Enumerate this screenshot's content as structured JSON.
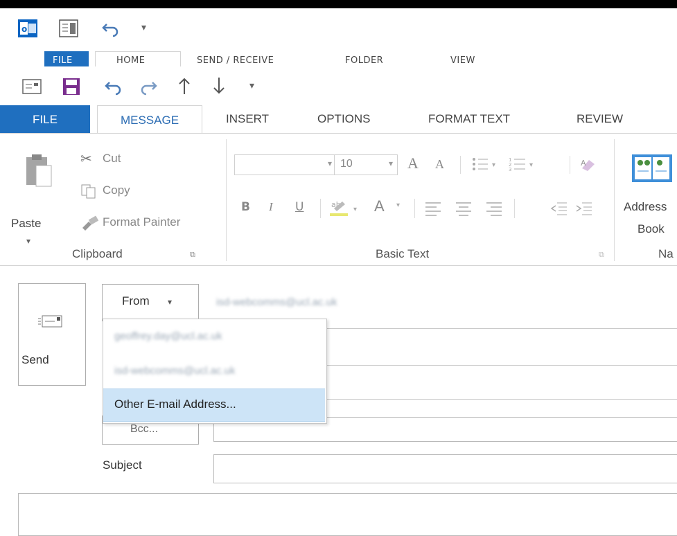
{
  "background_window": {
    "tabs": [
      "FILE",
      "HOME",
      "SEND / RECEIVE",
      "FOLDER",
      "VIEW"
    ]
  },
  "ribbon_tabs": {
    "file": "FILE",
    "message": "MESSAGE",
    "insert": "INSERT",
    "options": "OPTIONS",
    "format_text": "FORMAT TEXT",
    "review": "REVIEW"
  },
  "clipboard": {
    "paste": "Paste",
    "cut": "Cut",
    "copy": "Copy",
    "format_painter": "Format Painter",
    "group_label": "Clipboard"
  },
  "basic_text": {
    "font_name": "",
    "font_size": "10",
    "bold": "B",
    "italic": "I",
    "underline": "U",
    "font_color": "A",
    "grow_font": "A",
    "shrink_font": "A",
    "group_label": "Basic Text"
  },
  "names": {
    "address_book_line1": "Address",
    "address_book_line2": "Book",
    "group_label_partial": "Na"
  },
  "compose": {
    "send_label": "Send",
    "from_button": "From",
    "from_value": "isd-webcomms@ucl.ac.uk",
    "bcc_button": "Bcc...",
    "subject_label": "Subject",
    "subject_value": ""
  },
  "from_dropdown": {
    "options": [
      "geoffrey.day@ucl.ac.uk",
      "isd-webcomms@ucl.ac.uk"
    ],
    "other": "Other E-mail Address..."
  },
  "colors": {
    "file_tab": "#1f6fbf",
    "active_tab_text": "#2b6cb3",
    "hover_item": "#cde4f7"
  }
}
